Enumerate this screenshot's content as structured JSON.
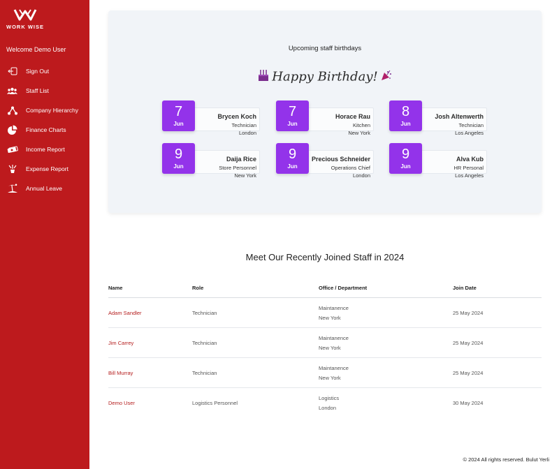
{
  "brand": {
    "name": "WORK WISE"
  },
  "sidebar": {
    "welcome": "Welcome Demo User",
    "items": [
      {
        "label": "Sign Out",
        "icon": "sign-out-icon"
      },
      {
        "label": "Staff List",
        "icon": "users-icon"
      },
      {
        "label": "Company Hierarchy",
        "icon": "hierarchy-icon"
      },
      {
        "label": "Finance Charts",
        "icon": "pie-chart-icon"
      },
      {
        "label": "Income Report",
        "icon": "money-icon"
      },
      {
        "label": "Expense Report",
        "icon": "expense-icon"
      },
      {
        "label": "Annual Leave",
        "icon": "beach-icon"
      }
    ]
  },
  "birthdays": {
    "title": "Upcoming staff birthdays",
    "banner": "Happy Birthday!",
    "people": [
      {
        "day": "7",
        "month": "Jun",
        "name": "Brycen Koch",
        "role": "Technician",
        "city": "London"
      },
      {
        "day": "7",
        "month": "Jun",
        "name": "Horace Rau",
        "role": "Kitchen",
        "city": "New York"
      },
      {
        "day": "8",
        "month": "Jun",
        "name": "Josh Altenwerth",
        "role": "Technician",
        "city": "Los Angeles"
      },
      {
        "day": "9",
        "month": "Jun",
        "name": "Daija Rice",
        "role": "Store Personnel",
        "city": "New York"
      },
      {
        "day": "9",
        "month": "Jun",
        "name": "Precious Schneider",
        "role": "Operations Chief",
        "city": "London"
      },
      {
        "day": "9",
        "month": "Jun",
        "name": "Alva Kub",
        "role": "HR Personal",
        "city": "Los Angeles"
      }
    ]
  },
  "joined": {
    "title": "Meet Our Recently Joined Staff in 2024",
    "headers": {
      "name": "Name",
      "role": "Role",
      "office": "Office / Department",
      "date": "Join Date"
    },
    "rows": [
      {
        "name": "Adam Sandler",
        "role": "Technician",
        "department": "Maintanence",
        "office": "New York",
        "date": "25 May 2024"
      },
      {
        "name": "Jim Carrey",
        "role": "Technician",
        "department": "Maintanence",
        "office": "New York",
        "date": "25 May 2024"
      },
      {
        "name": "Bill Murray",
        "role": "Technician",
        "department": "Maintanence",
        "office": "New York",
        "date": "25 May 2024"
      },
      {
        "name": "Demo User",
        "role": "Logistics Personnel",
        "department": "Logistics",
        "office": "London",
        "date": "30 May 2024"
      }
    ]
  },
  "footer": {
    "text": "© 2024 All rights reserved. Bulut Yerli"
  },
  "colors": {
    "sidebar": "#bd1a1d",
    "accent": "#9333ea",
    "link": "#b41c1c",
    "card": "#f1f4f8"
  }
}
